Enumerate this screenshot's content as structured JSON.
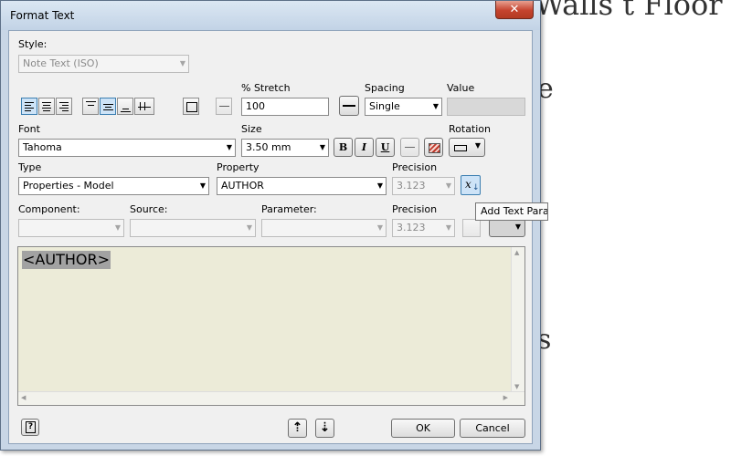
{
  "window": {
    "title": "Format Text",
    "close_glyph": "✕"
  },
  "background": {
    "snippet_1": "Walls t Floor",
    "snippet_2": "e",
    "snippet_3": "s"
  },
  "style": {
    "label": "Style:",
    "value": "Note Text (ISO)"
  },
  "stretch": {
    "label": "% Stretch",
    "value": "100"
  },
  "spacing": {
    "label": "Spacing",
    "value": "Single"
  },
  "value_field": {
    "label": "Value",
    "value": ""
  },
  "font": {
    "label": "Font",
    "value": "Tahoma"
  },
  "size": {
    "label": "Size",
    "value": "3.50 mm"
  },
  "format_buttons": {
    "bold": "B",
    "italic": "I",
    "underline": "U"
  },
  "rotation": {
    "label": "Rotation"
  },
  "type": {
    "label": "Type",
    "value": "Properties - Model"
  },
  "property": {
    "label": "Property",
    "value": "AUTHOR"
  },
  "precision1": {
    "label": "Precision",
    "value": "3.123"
  },
  "component": {
    "label": "Component:",
    "value": ""
  },
  "source": {
    "label": "Source:",
    "value": ""
  },
  "parameter": {
    "label": "Parameter:",
    "value": ""
  },
  "precision2": {
    "label": "Precision",
    "value": "3.123"
  },
  "tooltip": {
    "text": "Add Text Parameter"
  },
  "editor": {
    "text": "<AUTHOR>"
  },
  "footer": {
    "ok": "OK",
    "cancel": "Cancel"
  },
  "colors": {
    "editor_bg": "#ecebd8",
    "title_bg": "#c8d6e6",
    "close_red": "#c5432e"
  }
}
